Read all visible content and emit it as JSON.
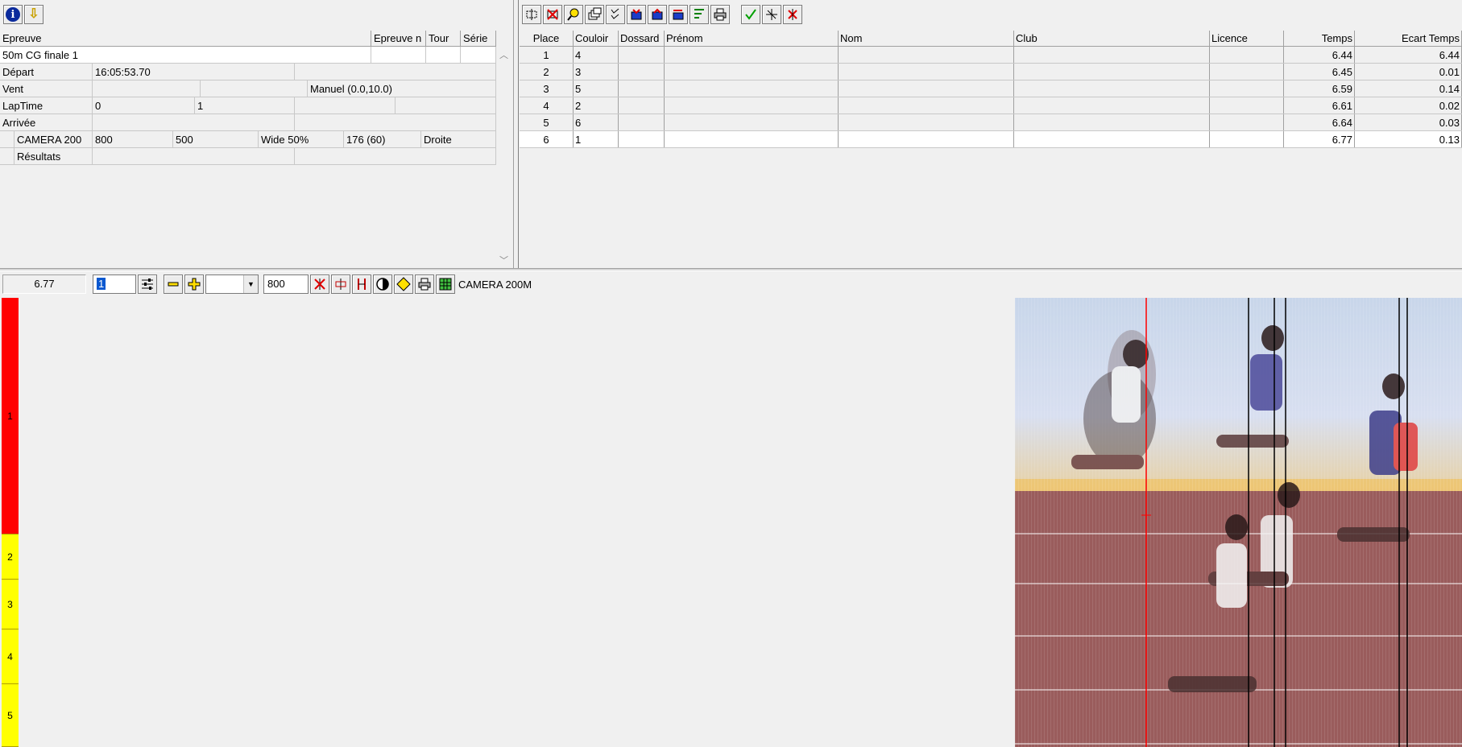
{
  "left_toolbar": {
    "info_icon": "i",
    "down_icon": "⇩"
  },
  "event_form": {
    "headers": [
      "Epreuve",
      "Epreuve n",
      "Tour",
      "Série"
    ],
    "event_name": "50m CG finale 1",
    "rows": {
      "depart": {
        "label": "Départ",
        "value": "16:05:53.70"
      },
      "vent": {
        "label": "Vent",
        "value": "Manuel (0.0,10.0)"
      },
      "laptime": {
        "label": "LapTime",
        "v1": "0",
        "v2": "1"
      },
      "arrivee": {
        "label": "Arrivée"
      },
      "camera": {
        "name": "CAMERA 200",
        "v1": "800",
        "v2": "500",
        "mode": "Wide 50%",
        "v3": "176  (60)",
        "side": "Droite"
      },
      "resultats": {
        "label": "Résultats"
      }
    }
  },
  "results": {
    "headers": [
      "Place",
      "Couloir",
      "Dossard",
      "Prénom",
      "Nom",
      "Club",
      "Licence",
      "Temps",
      "Ecart Temps"
    ],
    "rows": [
      {
        "place": "1",
        "couloir": "4",
        "temps": "6.44",
        "ecart": "6.44"
      },
      {
        "place": "2",
        "couloir": "3",
        "temps": "6.45",
        "ecart": "0.01"
      },
      {
        "place": "3",
        "couloir": "5",
        "temps": "6.59",
        "ecart": "0.14"
      },
      {
        "place": "4",
        "couloir": "2",
        "temps": "6.61",
        "ecart": "0.02"
      },
      {
        "place": "5",
        "couloir": "6",
        "temps": "6.64",
        "ecart": "0.03"
      },
      {
        "place": "6",
        "couloir": "1",
        "temps": "6.77",
        "ecart": "0.13"
      }
    ]
  },
  "image_toolbar": {
    "time_value": "6.77",
    "zoom_value": "1",
    "width_value": "800",
    "camera_label": "CAMERA 200M"
  },
  "lanes": [
    {
      "label": "1",
      "color": "#ff0000"
    },
    {
      "label": "2",
      "color": "#ffff00"
    },
    {
      "label": "3",
      "color": "#ffff00"
    },
    {
      "label": "4",
      "color": "#ffff00"
    },
    {
      "label": "5",
      "color": "#ffff00"
    }
  ]
}
